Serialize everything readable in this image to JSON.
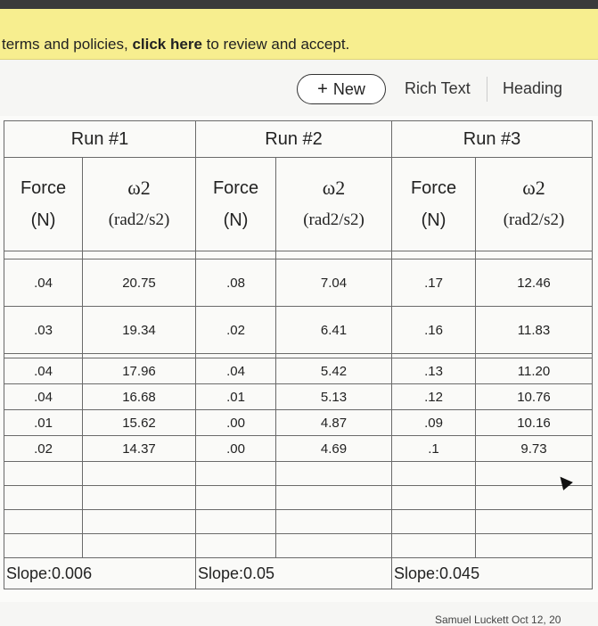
{
  "banner": {
    "text_before": "terms and policies, ",
    "link": "click here",
    "text_after": " to review and accept."
  },
  "toolbar": {
    "new_label": "New",
    "new_icon": "plus-icon",
    "rich_text": "Rich Text",
    "heading": "Heading"
  },
  "table": {
    "runs": [
      "Run #1",
      "Run #2",
      "Run #3"
    ],
    "force_label": "Force",
    "force_unit": "(N)",
    "omega_label": "ω2",
    "omega_unit": "(rad2/s2)",
    "rows": [
      [
        ".04",
        "20.75",
        ".08",
        "7.04",
        ".17",
        "12.46"
      ],
      [
        ".03",
        "19.34",
        ".02",
        "6.41",
        ".16",
        "11.83"
      ],
      [
        ".04",
        "17.96",
        ".04",
        "5.42",
        ".13",
        "11.20"
      ],
      [
        ".04",
        "16.68",
        ".01",
        "5.13",
        ".12",
        "10.76"
      ],
      [
        ".01",
        "15.62",
        ".00",
        "4.87",
        ".09",
        "10.16"
      ],
      [
        ".02",
        "14.37",
        ".00",
        "4.69",
        ".1",
        "9.73"
      ]
    ],
    "slopes": [
      "Slope:0.006",
      "Slope:0.05",
      "Slope:0.045"
    ]
  },
  "footer": {
    "text": "Samuel Luckett    Oct 12, 20"
  }
}
